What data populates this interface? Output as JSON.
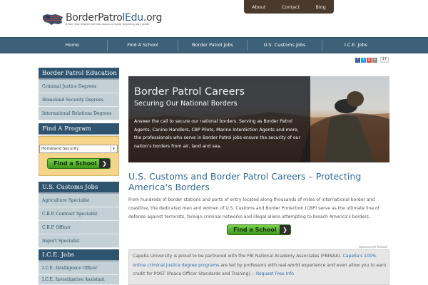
{
  "header": {
    "top_links": [
      "About",
      "Contact",
      "Blog"
    ],
    "logo_main": "BorderPatrol",
    "logo_edu": "Edu",
    "logo_tld": ".org",
    "logo_tagline": "A four year degree will help assure a higher beginning pay grade"
  },
  "nav": {
    "items": [
      "Home",
      "Find A School",
      "Border Patrol Jobs",
      "U.S. Customs Jobs",
      "I.C.E. Jobs"
    ]
  },
  "share": {
    "icons": [
      "facebook-icon",
      "twitter-icon",
      "googleplus-icon",
      "share-icon"
    ],
    "count": "17"
  },
  "sidebar": {
    "education": {
      "title": "Border Patrol Education",
      "items": [
        "Criminal Justice Degrees",
        "Homeland Security Degrees",
        "International Relations Degrees"
      ]
    },
    "find_program": {
      "title": "Find A Program",
      "selected": "Homeland Security",
      "button": "Find a School"
    },
    "customs": {
      "title": "U.S. Customs Jobs",
      "items": [
        "Agriculture Specialist",
        "C.B.P. Contract Specialist",
        "C.B.P. Officer",
        "Import Specialist"
      ]
    },
    "ice": {
      "title": "I.C.E. Jobs",
      "items": [
        "I.C.E. Intelligence Officer",
        "I.C.E. Investigative Assistant"
      ]
    }
  },
  "hero": {
    "title": "Border Patrol Careers",
    "subtitle": "Securing Our National Borders",
    "text": "Answer the call to secure our national borders. Serving as Border Patrol Agents, Canine Handlers, CBP Pilots, Marine Interdiction Agents and more, the professionals who serve in Border Patrol jobs ensure the security of our nation's borders from air, land and sea."
  },
  "main": {
    "heading": "U.S. Customs and Border Patrol Careers – Protecting America's Borders",
    "paragraph": "From hundreds of border stations and ports of entry located along thousands of miles of international border and coastline, the dedicated men and women of U.S. Customs and Border Protection (CBP) serve as the ultimate line of defense against terrorists, foreign criminal networks and illegal aliens attempting to breach America's borders.",
    "button": "Find a School"
  },
  "sponsored": {
    "label": "Sponsored School",
    "text_a": "Capella University is proud to be partnered with the FBI National Academy Associates (FBINAA).",
    "link_a": "Capella's 100% online criminal justice degree programs",
    "text_b": "are led by professors with real-world experience and even allow you to earn credit for POST (Peace Officer Standards and Training). -",
    "link_b": "Request Free Info"
  },
  "colors": {
    "nav_bg": "#3d6178",
    "sidebar_head": "#2f5470",
    "sidebar_item": "#c3d1d6",
    "heading": "#2f6a93",
    "button_green": "#4fae26"
  }
}
